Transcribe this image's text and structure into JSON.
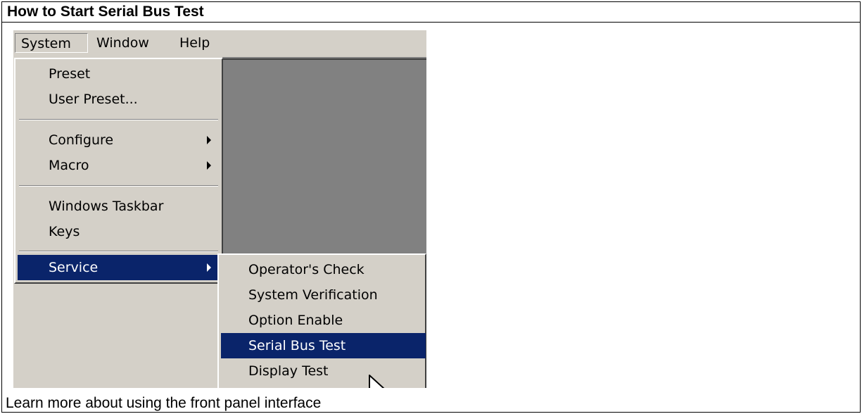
{
  "header": {
    "title": "How to Start Serial Bus Test"
  },
  "menubar": {
    "items": [
      "System",
      "Window",
      "Help"
    ]
  },
  "system_menu": {
    "items": [
      {
        "label": "Preset"
      },
      {
        "label": "User Preset..."
      },
      {
        "label": "Configure",
        "submenu": true
      },
      {
        "label": "Macro",
        "submenu": true
      },
      {
        "label": "Windows Taskbar"
      },
      {
        "label": "Keys"
      },
      {
        "label": "Service",
        "submenu": true,
        "highlighted": true
      }
    ]
  },
  "service_submenu": {
    "items": [
      {
        "label": "Operator's Check"
      },
      {
        "label": "System Verification"
      },
      {
        "label": "Option Enable"
      },
      {
        "label": "Serial Bus Test",
        "highlighted": true
      },
      {
        "label": "Display Test"
      }
    ]
  },
  "footer": {
    "link_text": "Learn more about using the front panel interface"
  },
  "colors": {
    "menu_bg": "#d4d0c8",
    "highlight": "#0a246a",
    "desktop": "#818181"
  },
  "cursor": {
    "icon": "arrow-pointer-icon"
  }
}
